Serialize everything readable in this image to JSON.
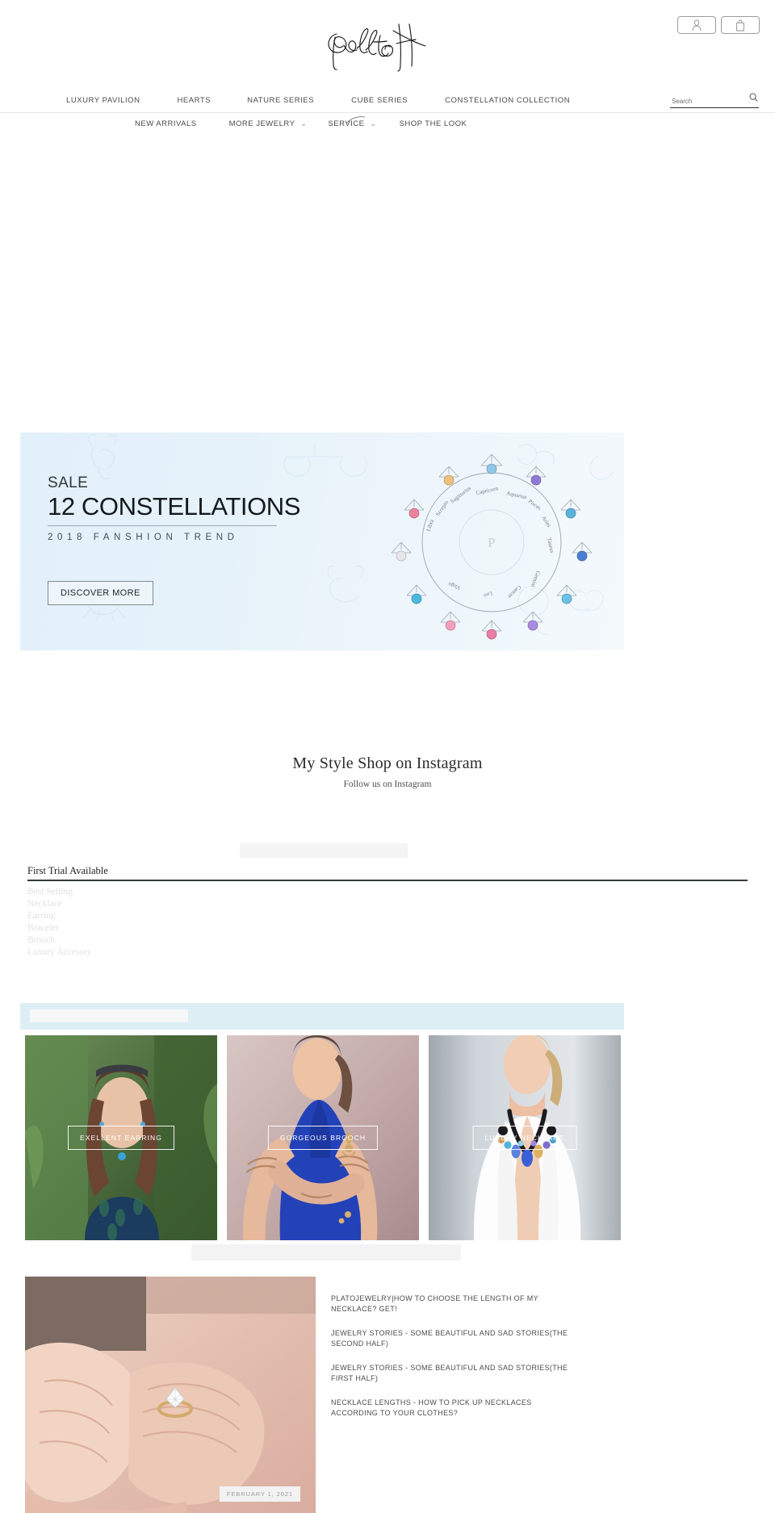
{
  "brand": {
    "name": "PlatoH",
    "logo_alt": "PlatoH signature logo"
  },
  "header": {
    "account_icon": "user-icon",
    "cart_icon": "shopping-bag-icon"
  },
  "search": {
    "placeholder": "Search",
    "value": "",
    "icon": "search-icon"
  },
  "nav_primary": [
    {
      "label": "LUXURY PAVILION"
    },
    {
      "label": "HEARTS"
    },
    {
      "label": "NATURE SERIES"
    },
    {
      "label": "CUBE SERIES"
    },
    {
      "label": "CONSTELLATION COLLECTION"
    }
  ],
  "nav_secondary": [
    {
      "label": "NEW ARRIVALS",
      "has_dropdown": false
    },
    {
      "label": "MORE JEWELRY",
      "has_dropdown": true,
      "chevron": "⌄"
    },
    {
      "label": "SERVICE",
      "has_dropdown": true,
      "chevron": "⌄"
    },
    {
      "label": "SHOP THE LOOK",
      "has_dropdown": false
    }
  ],
  "hero": {
    "eyebrow": "SALE",
    "headline": "12 CONSTELLATIONS",
    "subline": "2018  FANSHION  TREND",
    "cta": "DISCOVER MORE",
    "bg_color": "#e4f1f9",
    "art_alt": "Twelve zodiac constellation pendant necklaces arranged in a circle",
    "zodiac_labels": [
      "Libra",
      "Scorpio",
      "Sagittarius",
      "Capricorn",
      "Aquarius",
      "Pisces",
      "Aries",
      "Taurus",
      "Gemini",
      "Cancer",
      "Leo",
      "Virgo"
    ]
  },
  "instagram": {
    "title": "My Style Shop on Instagram",
    "subtitle": "Follow us on Instagram"
  },
  "categories": {
    "title": "First Trial Available",
    "items": [
      {
        "label": "Best Selling"
      },
      {
        "label": "Necklace"
      },
      {
        "label": "Earring"
      },
      {
        "label": "Bracelet"
      },
      {
        "label": "Brooch"
      },
      {
        "label": "Luxury Accesory"
      }
    ]
  },
  "collection_cards": [
    {
      "label": "EXELLENT EARRING",
      "img_alt": "Woman in tropical setting wearing blue drop earrings and sunglasses on head"
    },
    {
      "label": "GORGEOUS BROOCH",
      "img_alt": "Model in royal blue dress with gold brooch and henna arm tattoos"
    },
    {
      "label": "LUXURY NECKLACE",
      "img_alt": "Blonde model in white blazer wearing a multicolor gemstone statement necklace"
    }
  ],
  "blog": {
    "featured_image_alt": "Close-up of hands holding a diamond solitaire ring",
    "featured_date": "FEBRUARY 1, 2021",
    "posts": [
      {
        "title": "PLATOJEWELRY|HOW TO CHOOSE THE LENGTH OF MY NECKLACE? GET!"
      },
      {
        "title": "JEWELRY STORIES - SOME BEAUTIFUL AND SAD STORIES(THE SECOND HALF)"
      },
      {
        "title": "JEWELRY STORIES - SOME BEAUTIFUL AND SAD STORIES(THE FIRST HALF)"
      },
      {
        "title": "NECKLACE LENGTHS - HOW TO PICK UP NECKLACES ACCORDING TO YOUR CLOTHES?"
      }
    ]
  },
  "colors": {
    "hero_bg": "#e4f1f9",
    "blue_bar": "#ddeef5",
    "text_dark": "#2b2b2b",
    "text_muted": "#4a4a4a",
    "category_muted": "#e2e2e2"
  }
}
